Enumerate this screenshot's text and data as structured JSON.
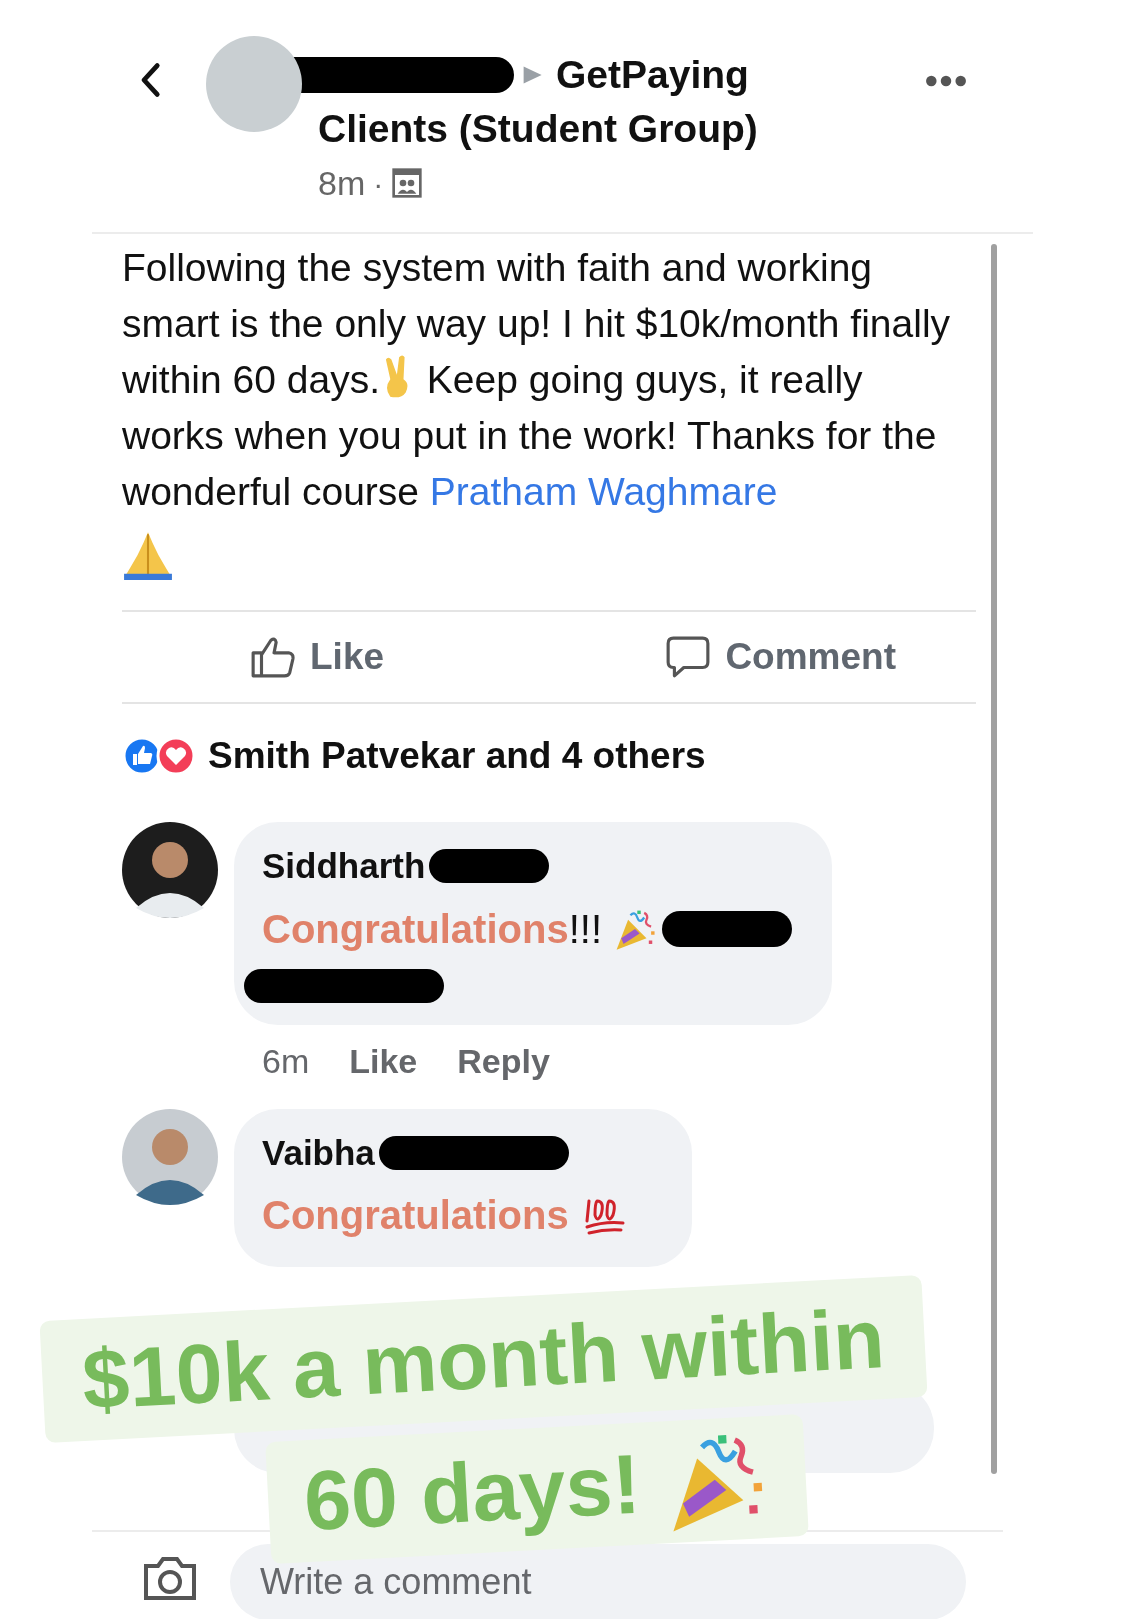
{
  "header": {
    "group_name_start": "GetPaying",
    "group_name_rest": "Clients (Student Group)",
    "time": "8m",
    "separator": "·"
  },
  "post": {
    "text": "Following the system with faith and working smart is the only way up! I hit $10k/month finally within 60 days.",
    "text_after": " Keep going guys, it really works when you put in the work! Thanks for the wonderful course ",
    "link": "Pratham Waghmare"
  },
  "actions": [
    {
      "kind": "like",
      "label": "Like"
    },
    {
      "kind": "comment",
      "label": "Comment"
    }
  ],
  "reactions": {
    "text": "Smith Patvekar and 4 others"
  },
  "comments": [
    {
      "kind": "party",
      "author": "Siddharth",
      "highlight": "Congratulations",
      "rest": "!!!",
      "time": "6m",
      "actions": [
        "Like",
        "Reply"
      ]
    },
    {
      "kind": "hundred",
      "author": "Vaibha",
      "highlight": "Congratulations"
    }
  ],
  "composer": {
    "placeholder": "Write a comment"
  },
  "sticker": {
    "line_1": "$10k a month within",
    "line_2": "60 days!"
  }
}
